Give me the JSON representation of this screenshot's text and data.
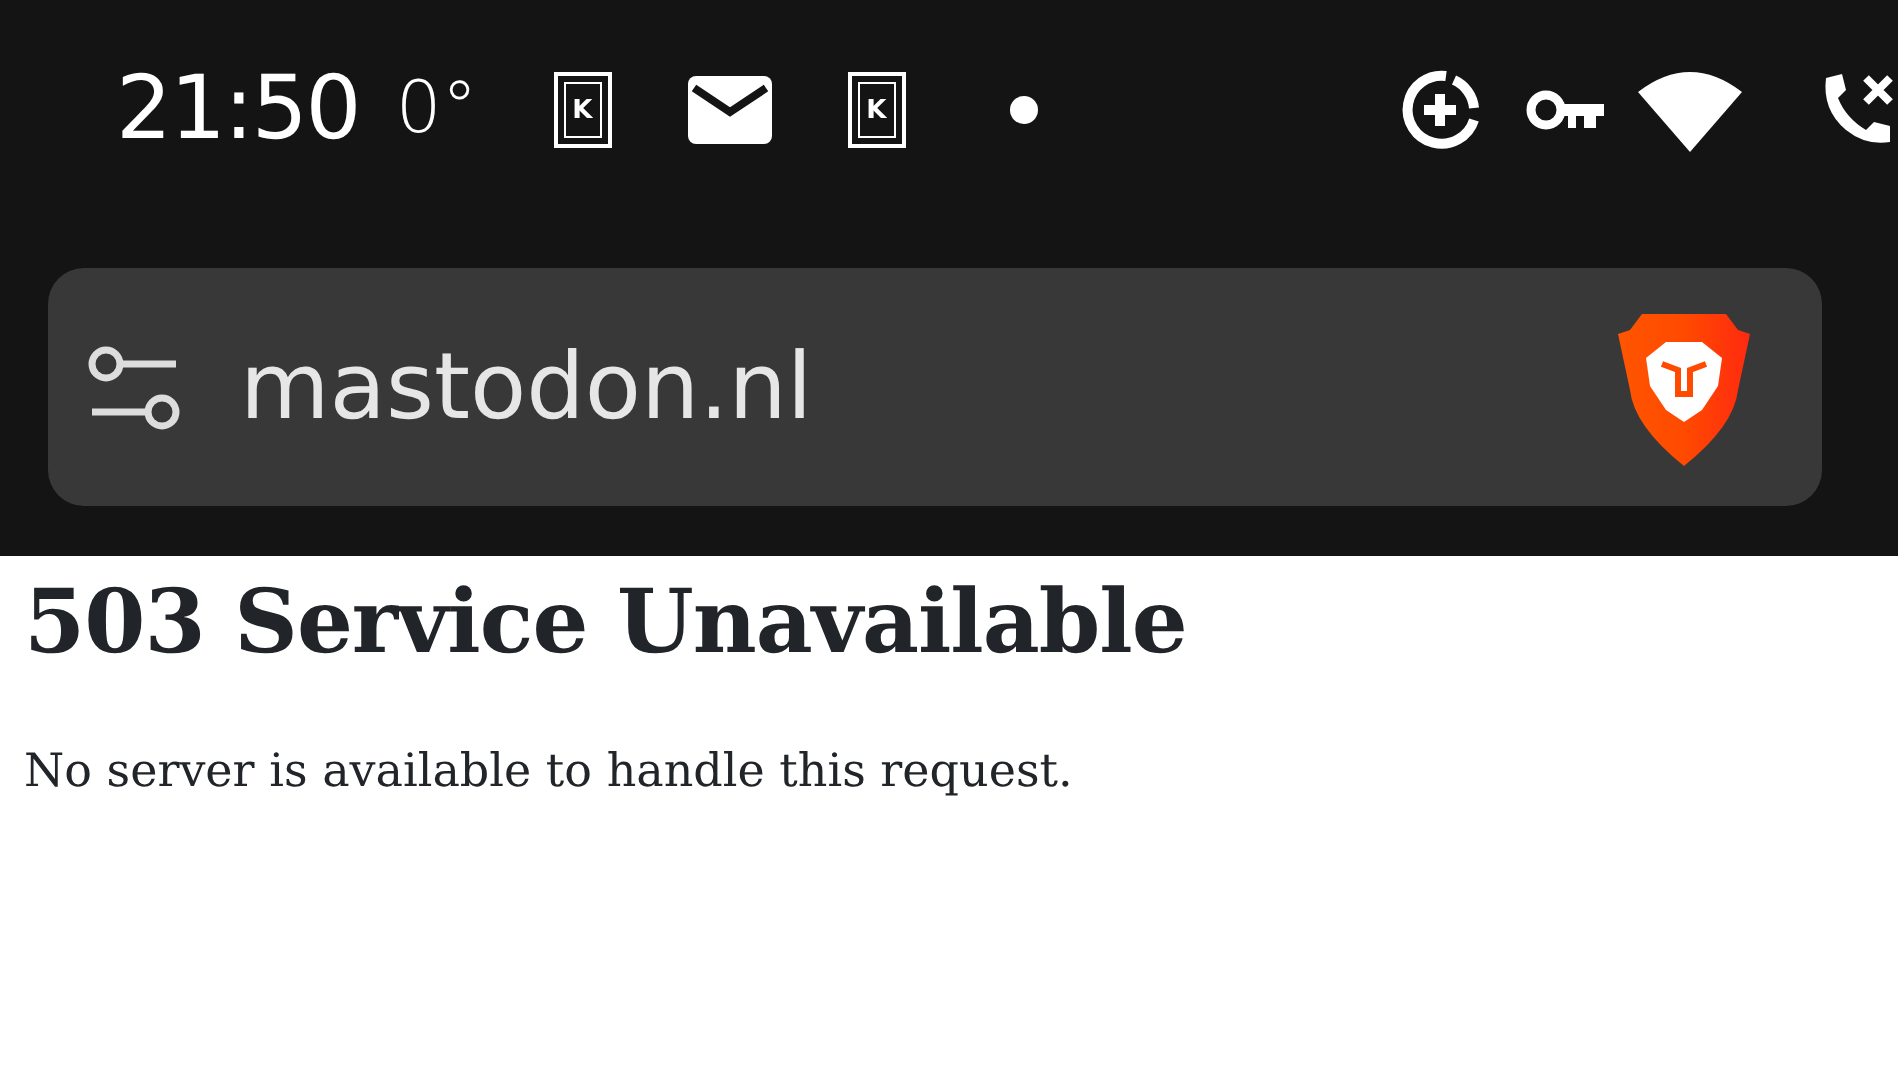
{
  "status_bar": {
    "time": "21:50",
    "temperature": "0°",
    "notification_icons": [
      {
        "kind": "app",
        "label": "K"
      },
      {
        "kind": "mail"
      },
      {
        "kind": "app",
        "label": "K"
      },
      {
        "kind": "dot"
      }
    ],
    "system_icons": [
      {
        "kind": "data-saver"
      },
      {
        "kind": "vpn-key"
      },
      {
        "kind": "wifi"
      },
      {
        "kind": "call"
      }
    ]
  },
  "address_bar": {
    "url": "mastodon.nl"
  },
  "page": {
    "heading": "503 Service Unavailable",
    "message": "No server is available to handle this request."
  }
}
